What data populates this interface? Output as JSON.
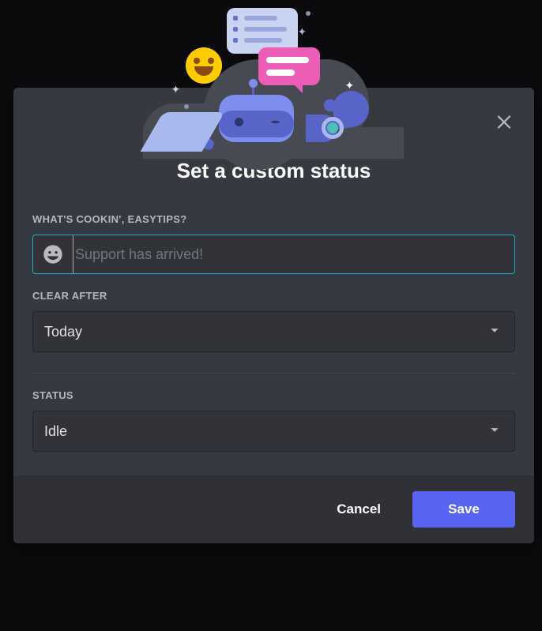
{
  "modal": {
    "title": "Set a custom status",
    "labels": {
      "prompt": "What's cookin', EasyTips?",
      "clear_after": "Clear After",
      "status": "Status"
    },
    "status_input": {
      "value": "",
      "placeholder": "Support has arrived!"
    },
    "clear_after": {
      "selected": "Today"
    },
    "status": {
      "selected": "Idle"
    },
    "buttons": {
      "cancel": "Cancel",
      "save": "Save"
    }
  },
  "icons": {
    "close": "close-icon",
    "emoji_picker": "smile-icon",
    "chevron": "chevron-down-icon"
  }
}
